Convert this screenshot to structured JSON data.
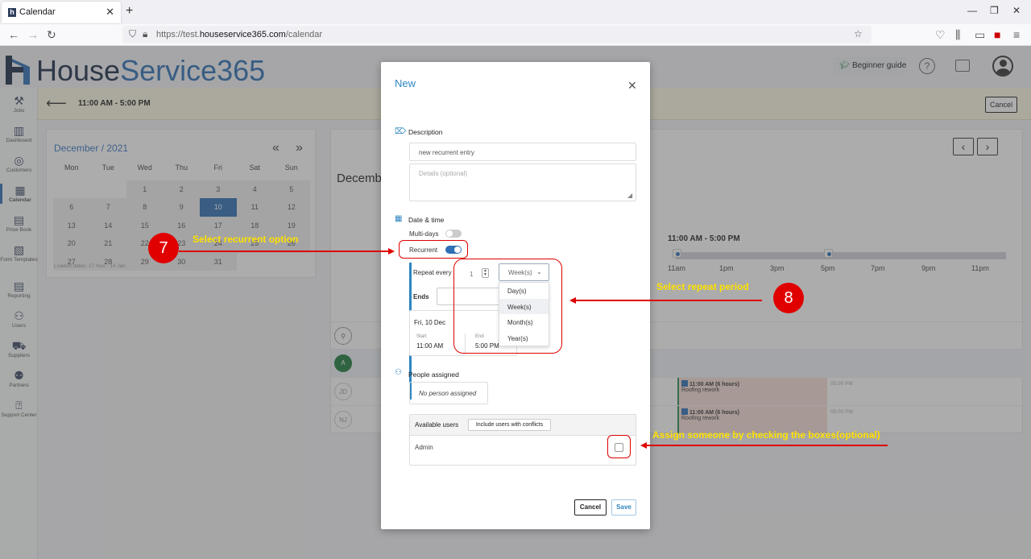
{
  "browser": {
    "tab_title": "Calendar",
    "url_prefix": "https://test.",
    "url_domain": "houseservice365.com",
    "url_path": "/calendar"
  },
  "app": {
    "logo_part1": "House",
    "logo_part2": "Service365",
    "beginner_guide": "Beginner guide",
    "time_range": "11:00 AM - 5:00 PM",
    "cancel_label": "Cancel"
  },
  "sidebar": {
    "items": [
      {
        "label": "Jobs",
        "icon": "tools-icon"
      },
      {
        "label": "Dashboard",
        "icon": "chart-icon"
      },
      {
        "label": "Customers",
        "icon": "customers-icon"
      },
      {
        "label": "Calendar",
        "icon": "calendar-icon"
      },
      {
        "label": "Price Book",
        "icon": "pricebook-icon"
      },
      {
        "label": "Form Templates",
        "icon": "form-icon"
      },
      {
        "label": "Reporting",
        "icon": "report-icon"
      },
      {
        "label": "Users",
        "icon": "users-icon"
      },
      {
        "label": "Suppliers",
        "icon": "truck-icon"
      },
      {
        "label": "Partners",
        "icon": "partners-icon"
      },
      {
        "label": "Support Center",
        "icon": "support-icon"
      }
    ]
  },
  "mini_calendar": {
    "title": "December / 2021",
    "weekdays": [
      "Mon",
      "Tue",
      "Wed",
      "Thu",
      "Fri",
      "Sat",
      "Sun"
    ],
    "weeks": [
      [
        "",
        "",
        "1",
        "2",
        "3",
        "4",
        "5"
      ],
      [
        "6",
        "7",
        "8",
        "9",
        "10",
        "11",
        "12"
      ],
      [
        "13",
        "14",
        "15",
        "16",
        "17",
        "18",
        "19"
      ],
      [
        "20",
        "21",
        "22",
        "23",
        "24",
        "25",
        "26"
      ],
      [
        "27",
        "28",
        "29",
        "30",
        "31",
        "",
        ""
      ]
    ],
    "today": "10",
    "loaded": "Loaded dates: 17 Nov - 14 Jan"
  },
  "scheduler": {
    "month": "December",
    "range": "11:00 AM - 5:00 PM",
    "hours": [
      "11am",
      "1pm",
      "3pm",
      "5pm",
      "7pm",
      "9pm",
      "11pm"
    ],
    "rows": [
      {
        "avatar": "A"
      },
      {
        "avatar": "JD",
        "event_time": "11:00 AM (6 hours)",
        "event_title": "Roofing rework",
        "after": "05:00 PM"
      },
      {
        "avatar": "NJ",
        "event_time": "11:00 AM (6 hours)",
        "event_title": "Roofing rework",
        "after": "05:00 PM"
      }
    ]
  },
  "modal": {
    "title": "New",
    "description_label": "Description",
    "description_value": "new recurrent entry",
    "details_placeholder": "Details (optional)",
    "datetime_label": "Date & time",
    "multidays_label": "Multi-days",
    "multidays_on": false,
    "recurrent_label": "Recurrent",
    "recurrent_on": true,
    "repeat_every_label": "Repeat every",
    "repeat_every_value": "1",
    "period_value": "Week(s)",
    "period_options": [
      "Day(s)",
      "Week(s)",
      "Month(s)",
      "Year(s)"
    ],
    "ends_label": "Ends",
    "date": "Fri, 10 Dec",
    "start_label": "Start",
    "start_value": "11:00 AM",
    "end_label": "End",
    "end_value": "5:00 PM",
    "people_label": "People assigned",
    "no_person": "No person assigned",
    "available_users": "Available users",
    "include_conflicts": "Include users with conflicts",
    "users": [
      "Admin"
    ],
    "cancel": "Cancel",
    "save": "Save"
  },
  "annotations": {
    "step7_number": "7",
    "step7_text": "Select recurrent option",
    "step8_number": "8",
    "step8_text": "Select repeat period",
    "assign_text": "Assign someone by checking the boxes(optional)"
  },
  "colors": {
    "accent": "#2e86c1",
    "annotation_red": "#e00000",
    "annotation_text": "#ffe000"
  }
}
